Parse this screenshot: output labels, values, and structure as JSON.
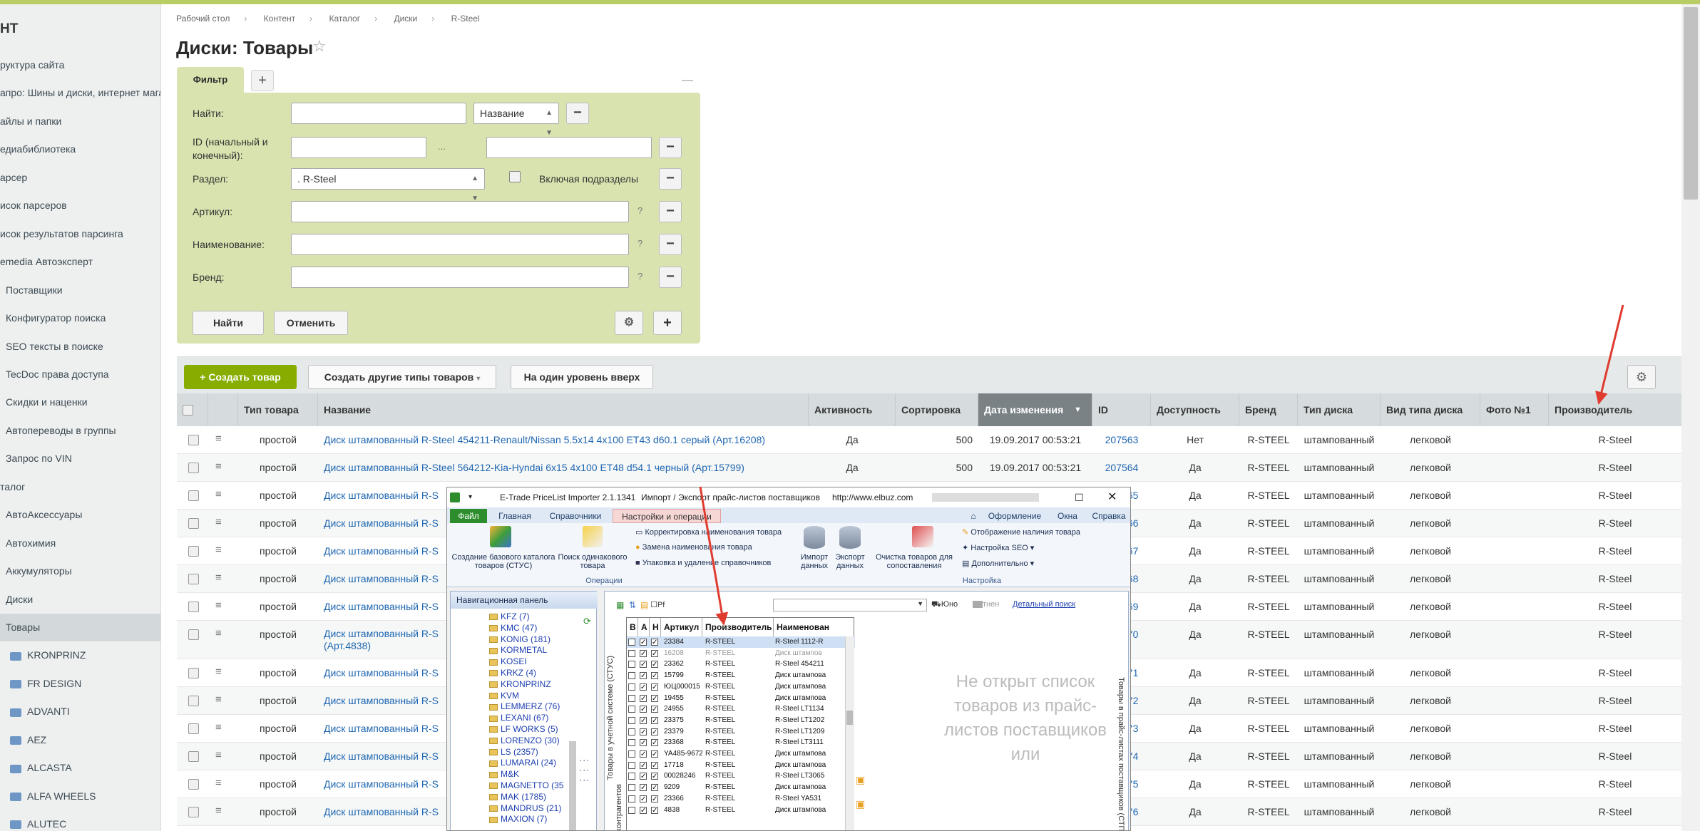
{
  "sidebar": {
    "title": "НТ",
    "items": [
      {
        "label": "руктура сайта",
        "indent": false,
        "folder": false
      },
      {
        "label": "апро: Шины и диски, интернет мага",
        "indent": false,
        "folder": false
      },
      {
        "label": "айлы и папки",
        "indent": false,
        "folder": false
      },
      {
        "label": "едиабиблиотека",
        "indent": false,
        "folder": false
      },
      {
        "label": "арсер",
        "indent": false,
        "folder": false
      },
      {
        "label": "исок парсеров",
        "indent": false,
        "folder": false
      },
      {
        "label": "исок результатов парсинга",
        "indent": false,
        "folder": false
      },
      {
        "label": "emedia Автоэксперт",
        "indent": false,
        "folder": false
      },
      {
        "label": "Поставщики",
        "indent": true,
        "folder": false
      },
      {
        "label": "Конфигуратор поиска",
        "indent": true,
        "folder": false
      },
      {
        "label": "SEO тексты в поиске",
        "indent": true,
        "folder": false
      },
      {
        "label": "TecDoc права доступа",
        "indent": true,
        "folder": false
      },
      {
        "label": "Скидки и наценки",
        "indent": true,
        "folder": false
      },
      {
        "label": "Автопереводы в группы",
        "indent": true,
        "folder": false
      },
      {
        "label": "Запрос по VIN",
        "indent": true,
        "folder": false
      },
      {
        "label": "талог",
        "indent": false,
        "folder": false
      },
      {
        "label": "АвтоАксессуары",
        "indent": true,
        "folder": false
      },
      {
        "label": "Автохимия",
        "indent": true,
        "folder": false
      },
      {
        "label": "Аккумуляторы",
        "indent": true,
        "folder": false
      },
      {
        "label": "Диски",
        "indent": true,
        "folder": false
      },
      {
        "label": "Товары",
        "indent": true,
        "folder": false,
        "active": true
      },
      {
        "label": "KRONPRINZ",
        "indent": true,
        "folder": true
      },
      {
        "label": "FR DESIGN",
        "indent": true,
        "folder": true
      },
      {
        "label": "ADVANTI",
        "indent": true,
        "folder": true
      },
      {
        "label": "AEZ",
        "indent": true,
        "folder": true
      },
      {
        "label": "ALCASTA",
        "indent": true,
        "folder": true
      },
      {
        "label": "ALFA WHEELS",
        "indent": true,
        "folder": true
      },
      {
        "label": "ALUTEC",
        "indent": true,
        "folder": true
      }
    ]
  },
  "breadcrumbs": [
    "Рабочий стол",
    "Контент",
    "Каталог",
    "Диски",
    "R-Steel"
  ],
  "page_title": "Диски: Товары",
  "filter": {
    "tab_label": "Фильтр",
    "add_symbol": "+",
    "minimize_symbol": "—",
    "fields": {
      "name_label": "Найти:",
      "name_select": "Название",
      "id_label": "ID (начальный и конечный):",
      "range_sep": "...",
      "section_label": "Раздел:",
      "section_value": ". R-Steel",
      "include_sub_label": "Включая подразделы",
      "article_label": "Артикул:",
      "title_label": "Наименование:",
      "brand_label": "Бренд:",
      "help": "?",
      "minus": "−"
    },
    "find_button": "Найти",
    "cancel_button": "Отменить"
  },
  "toolbar": {
    "create_button": "Создать товар",
    "create_other_button": "Создать другие типы товаров",
    "up_level_button": "На один уровень вверх"
  },
  "table": {
    "columns": [
      "Тип товара",
      "Название",
      "Активность",
      "Сортировка",
      "Дата изменения",
      "ID",
      "Доступность",
      "Бренд",
      "Тип диска",
      "Вид типа диска",
      "Фото №1",
      "Производитель"
    ],
    "rows": [
      {
        "type": "простой",
        "name": "Диск штампованный R-Steel 454211-Renault/Nissan 5.5x14 4x100 ET43 d60.1 серый (Арт.16208)",
        "active": "Да",
        "sort": "500",
        "date": "19.09.2017 00:53:21",
        "id": "207563",
        "avail": "Нет",
        "brand": "R-STEEL",
        "disk": "штампованный",
        "kind": "легковой",
        "maker": "R-Steel"
      },
      {
        "type": "простой",
        "name": "Диск штампованный R-Steel 564212-Kia-Hyndai 6x15 4x100 ET48 d54.1 черный (Арт.15799)",
        "active": "Да",
        "sort": "500",
        "date": "19.09.2017 00:53:21",
        "id": "207564",
        "avail": "Да",
        "brand": "R-STEEL",
        "disk": "штампованный",
        "kind": "легковой",
        "maker": "R-Steel"
      },
      {
        "type": "простой",
        "name": "Диск штампованный R-S",
        "id": "207565",
        "avail": "Да",
        "brand": "R-STEEL",
        "disk": "штампованный",
        "kind": "легковой",
        "maker": "R-Steel"
      },
      {
        "type": "простой",
        "name": "Диск штампованный R-S",
        "id": "207566",
        "avail": "Да",
        "brand": "R-STEEL",
        "disk": "штампованный",
        "kind": "легковой",
        "maker": "R-Steel"
      },
      {
        "type": "простой",
        "name": "Диск штампованный R-S",
        "id": "207567",
        "avail": "Да",
        "brand": "R-STEEL",
        "disk": "штампованный",
        "kind": "легковой",
        "maker": "R-Steel"
      },
      {
        "type": "простой",
        "name": "Диск штампованный R-S",
        "id": "207568",
        "avail": "Да",
        "brand": "R-STEEL",
        "disk": "штампованный",
        "kind": "легковой",
        "maker": "R-Steel"
      },
      {
        "type": "простой",
        "name": "Диск штампованный R-S",
        "id": "207569",
        "avail": "Да",
        "brand": "R-STEEL",
        "disk": "штампованный",
        "kind": "легковой",
        "maker": "R-Steel"
      },
      {
        "type": "простой",
        "name": "Диск штампованный R-S",
        "name2": "(Арт.4838)",
        "id": "207570",
        "avail": "Да",
        "brand": "R-STEEL",
        "disk": "штампованный",
        "kind": "легковой",
        "maker": "R-Steel"
      },
      {
        "type": "простой",
        "name": "Диск штампованный R-S",
        "id": "207571",
        "avail": "Да",
        "brand": "R-STEEL",
        "disk": "штампованный",
        "kind": "легковой",
        "maker": "R-Steel"
      },
      {
        "type": "простой",
        "name": "Диск штампованный R-S",
        "id": "207572",
        "avail": "Да",
        "brand": "R-STEEL",
        "disk": "штампованный",
        "kind": "легковой",
        "maker": "R-Steel"
      },
      {
        "type": "простой",
        "name": "Диск штампованный R-S",
        "id": "207573",
        "avail": "Да",
        "brand": "R-STEEL",
        "disk": "штампованный",
        "kind": "легковой",
        "maker": "R-Steel"
      },
      {
        "type": "простой",
        "name": "Диск штампованный R-S",
        "id": "207574",
        "avail": "Да",
        "brand": "R-STEEL",
        "disk": "штампованный",
        "kind": "легковой",
        "maker": "R-Steel"
      },
      {
        "type": "простой",
        "name": "Диск штампованный R-S",
        "id": "207575",
        "avail": "Да",
        "brand": "R-STEEL",
        "disk": "штампованный",
        "kind": "легковой",
        "maker": "R-Steel"
      },
      {
        "type": "простой",
        "name": "Диск штампованный R-S",
        "id": "207576",
        "avail": "Да",
        "brand": "R-STEEL",
        "disk": "штампованный",
        "kind": "легковой",
        "maker": "R-Steel"
      }
    ]
  },
  "importer": {
    "title": "E-Trade PriceList Importer 2.1.1341",
    "subtitle": "Импорт / Экспорт прайс-листов поставщиков",
    "url": "http://www.elbuz.com",
    "tabs": [
      "Файл",
      "Главная",
      "Справочники",
      "Настройки и операции"
    ],
    "right_menu": [
      "Оформление",
      "Окна",
      "Справка"
    ],
    "ribbon": {
      "create_catalog": "Создание базового каталога товаров (СТУС)",
      "find_same": "Поиск одинакового товара",
      "correct_names": "Корректировка наименования товара",
      "replace_names": "Замена наименования товара",
      "pack_delete": "Упаковка и удаление справочников",
      "import_data": "Импорт данных",
      "export_data": "Экспорт данных",
      "clear_goods": "Очистка товаров для сопоставления",
      "show_stock": "Отображение наличия товара",
      "seo_settings": "Настройка SEO",
      "extra": "Дополнительно",
      "group_operations": "Операции",
      "group_settings": "Настройка"
    },
    "nav_title": "Навигационная панель",
    "tree": [
      "KFZ (7)",
      "KMC (47)",
      "KONIG (181)",
      "KORMETAL",
      "KOSEI",
      "KRKZ (4)",
      "KRONPRINZ",
      "KVM",
      "LEMMERZ (76)",
      "LEXANI (67)",
      "LF WORKS (5)",
      "LORENZO (30)",
      "LS (2357)",
      "LUMARAI (24)",
      "M&K",
      "MAGNETTO (35",
      "MAK (1785)",
      "MANDRUS (21)",
      "MAXION (7)"
    ],
    "search_link": "Детальный поиск",
    "tool_labels": [
      "Pf",
      "Юно",
      "тнен"
    ],
    "grid_headers": [
      "В",
      "А",
      "Н",
      "Артикул",
      "Производитель",
      "Наименован"
    ],
    "grid_rows": [
      [
        "23384",
        "R-STEEL",
        "R-Steel 1112-R"
      ],
      [
        "16208",
        "R-STEEL",
        "Диск штампов"
      ],
      [
        "23362",
        "R-STEEL",
        "R-Steel 454211"
      ],
      [
        "15799",
        "R-STEEL",
        "Диск штампова"
      ],
      [
        "ЮЦ000015",
        "R-STEEL",
        "Диск штампова"
      ],
      [
        "19455",
        "R-STEEL",
        "Диск штампова"
      ],
      [
        "24955",
        "R-STEEL",
        "R-Steel LT1134"
      ],
      [
        "23375",
        "R-STEEL",
        "R-Steel LT1202"
      ],
      [
        "23379",
        "R-STEEL",
        "R-Steel LT1209"
      ],
      [
        "23368",
        "R-STEEL",
        "R-Steel LT3111"
      ],
      [
        "YA485-9672",
        "R-STEEL",
        "Диск штампова"
      ],
      [
        "17718",
        "R-STEEL",
        "Диск штампова"
      ],
      [
        "00028246",
        "R-STEEL",
        "R-Steel LT3065"
      ],
      [
        "9209",
        "R-STEEL",
        "Диск штампова"
      ],
      [
        "23366",
        "R-STEEL",
        "R-Steel YA531"
      ],
      [
        "4838",
        "R-STEEL",
        "Диск штампова"
      ]
    ],
    "vertical_left": "Товары в учетной системе (СТУС)",
    "vertical_left2": "контрагентов",
    "vertical_right": "Товары в прайс-листах поставщиков (СТП",
    "placeholder": "Не открыт список товаров из прайс-листов поставщиков или"
  },
  "colors": {
    "accent_green": "#86ad00",
    "top_bar": "#b9cd65",
    "filter_bg": "#d8e3af",
    "arrow": "#e03b2f",
    "link": "#2067b0"
  }
}
